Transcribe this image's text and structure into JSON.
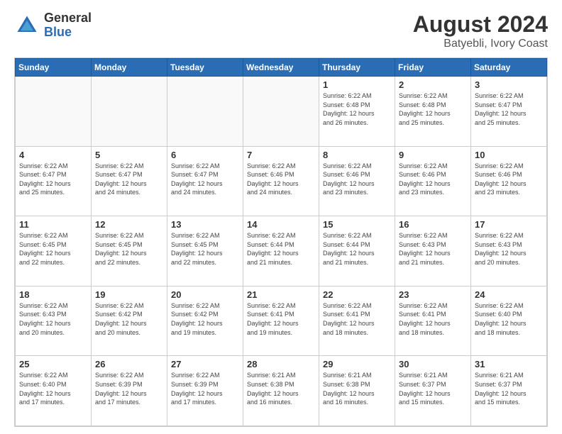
{
  "header": {
    "logo_general": "General",
    "logo_blue": "Blue",
    "main_title": "August 2024",
    "subtitle": "Batyebli, Ivory Coast"
  },
  "calendar": {
    "days_of_week": [
      "Sunday",
      "Monday",
      "Tuesday",
      "Wednesday",
      "Thursday",
      "Friday",
      "Saturday"
    ],
    "weeks": [
      [
        {
          "day": "",
          "info": ""
        },
        {
          "day": "",
          "info": ""
        },
        {
          "day": "",
          "info": ""
        },
        {
          "day": "",
          "info": ""
        },
        {
          "day": "1",
          "info": "Sunrise: 6:22 AM\nSunset: 6:48 PM\nDaylight: 12 hours\nand 26 minutes."
        },
        {
          "day": "2",
          "info": "Sunrise: 6:22 AM\nSunset: 6:48 PM\nDaylight: 12 hours\nand 25 minutes."
        },
        {
          "day": "3",
          "info": "Sunrise: 6:22 AM\nSunset: 6:47 PM\nDaylight: 12 hours\nand 25 minutes."
        }
      ],
      [
        {
          "day": "4",
          "info": "Sunrise: 6:22 AM\nSunset: 6:47 PM\nDaylight: 12 hours\nand 25 minutes."
        },
        {
          "day": "5",
          "info": "Sunrise: 6:22 AM\nSunset: 6:47 PM\nDaylight: 12 hours\nand 24 minutes."
        },
        {
          "day": "6",
          "info": "Sunrise: 6:22 AM\nSunset: 6:47 PM\nDaylight: 12 hours\nand 24 minutes."
        },
        {
          "day": "7",
          "info": "Sunrise: 6:22 AM\nSunset: 6:46 PM\nDaylight: 12 hours\nand 24 minutes."
        },
        {
          "day": "8",
          "info": "Sunrise: 6:22 AM\nSunset: 6:46 PM\nDaylight: 12 hours\nand 23 minutes."
        },
        {
          "day": "9",
          "info": "Sunrise: 6:22 AM\nSunset: 6:46 PM\nDaylight: 12 hours\nand 23 minutes."
        },
        {
          "day": "10",
          "info": "Sunrise: 6:22 AM\nSunset: 6:46 PM\nDaylight: 12 hours\nand 23 minutes."
        }
      ],
      [
        {
          "day": "11",
          "info": "Sunrise: 6:22 AM\nSunset: 6:45 PM\nDaylight: 12 hours\nand 22 minutes."
        },
        {
          "day": "12",
          "info": "Sunrise: 6:22 AM\nSunset: 6:45 PM\nDaylight: 12 hours\nand 22 minutes."
        },
        {
          "day": "13",
          "info": "Sunrise: 6:22 AM\nSunset: 6:45 PM\nDaylight: 12 hours\nand 22 minutes."
        },
        {
          "day": "14",
          "info": "Sunrise: 6:22 AM\nSunset: 6:44 PM\nDaylight: 12 hours\nand 21 minutes."
        },
        {
          "day": "15",
          "info": "Sunrise: 6:22 AM\nSunset: 6:44 PM\nDaylight: 12 hours\nand 21 minutes."
        },
        {
          "day": "16",
          "info": "Sunrise: 6:22 AM\nSunset: 6:43 PM\nDaylight: 12 hours\nand 21 minutes."
        },
        {
          "day": "17",
          "info": "Sunrise: 6:22 AM\nSunset: 6:43 PM\nDaylight: 12 hours\nand 20 minutes."
        }
      ],
      [
        {
          "day": "18",
          "info": "Sunrise: 6:22 AM\nSunset: 6:43 PM\nDaylight: 12 hours\nand 20 minutes."
        },
        {
          "day": "19",
          "info": "Sunrise: 6:22 AM\nSunset: 6:42 PM\nDaylight: 12 hours\nand 20 minutes."
        },
        {
          "day": "20",
          "info": "Sunrise: 6:22 AM\nSunset: 6:42 PM\nDaylight: 12 hours\nand 19 minutes."
        },
        {
          "day": "21",
          "info": "Sunrise: 6:22 AM\nSunset: 6:41 PM\nDaylight: 12 hours\nand 19 minutes."
        },
        {
          "day": "22",
          "info": "Sunrise: 6:22 AM\nSunset: 6:41 PM\nDaylight: 12 hours\nand 18 minutes."
        },
        {
          "day": "23",
          "info": "Sunrise: 6:22 AM\nSunset: 6:41 PM\nDaylight: 12 hours\nand 18 minutes."
        },
        {
          "day": "24",
          "info": "Sunrise: 6:22 AM\nSunset: 6:40 PM\nDaylight: 12 hours\nand 18 minutes."
        }
      ],
      [
        {
          "day": "25",
          "info": "Sunrise: 6:22 AM\nSunset: 6:40 PM\nDaylight: 12 hours\nand 17 minutes."
        },
        {
          "day": "26",
          "info": "Sunrise: 6:22 AM\nSunset: 6:39 PM\nDaylight: 12 hours\nand 17 minutes."
        },
        {
          "day": "27",
          "info": "Sunrise: 6:22 AM\nSunset: 6:39 PM\nDaylight: 12 hours\nand 17 minutes."
        },
        {
          "day": "28",
          "info": "Sunrise: 6:21 AM\nSunset: 6:38 PM\nDaylight: 12 hours\nand 16 minutes."
        },
        {
          "day": "29",
          "info": "Sunrise: 6:21 AM\nSunset: 6:38 PM\nDaylight: 12 hours\nand 16 minutes."
        },
        {
          "day": "30",
          "info": "Sunrise: 6:21 AM\nSunset: 6:37 PM\nDaylight: 12 hours\nand 15 minutes."
        },
        {
          "day": "31",
          "info": "Sunrise: 6:21 AM\nSunset: 6:37 PM\nDaylight: 12 hours\nand 15 minutes."
        }
      ]
    ]
  }
}
